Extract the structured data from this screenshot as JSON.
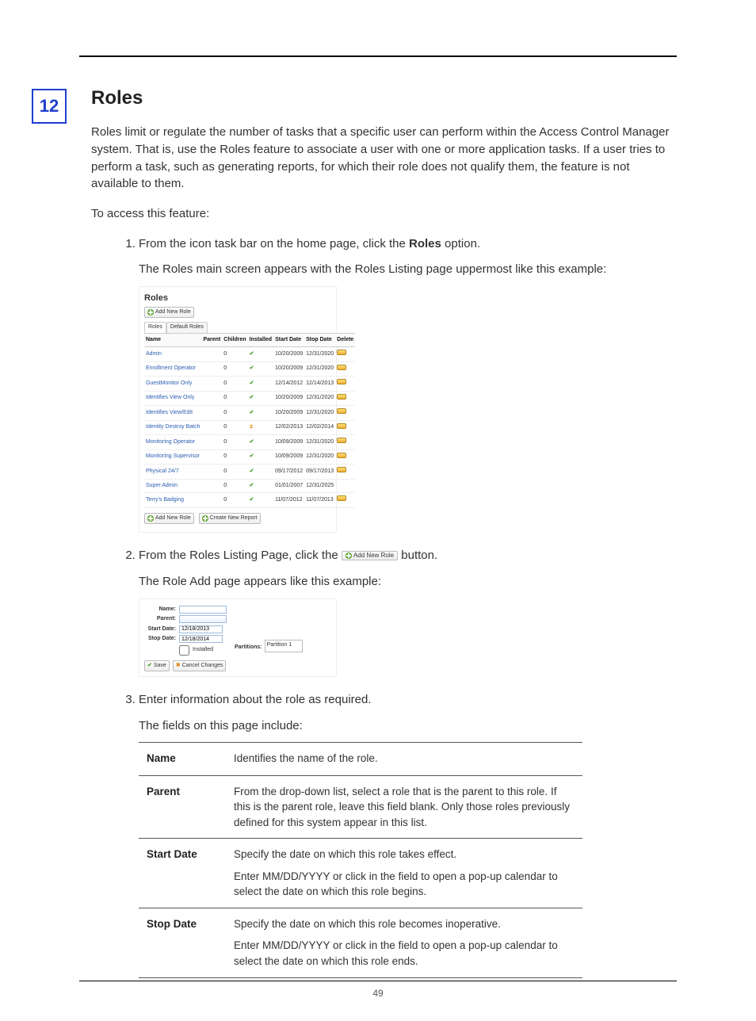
{
  "page": {
    "chapter_number": "12",
    "title": "Roles",
    "intro": "Roles limit or regulate the number of tasks that a specific user can perform within the Access Control Manager system. That is, use the Roles feature to associate a user with one or more application tasks. If a user tries to perform a task, such as generating reports, for which their role does not qualify them, the feature is not available to them.",
    "access_lead": "To access this feature:",
    "page_number": "49"
  },
  "steps": {
    "s1_pre": "From the icon task bar on the home page, click the ",
    "s1_strong": "Roles",
    "s1_post": " option.",
    "s1_result": "The Roles main screen appears with the Roles Listing page uppermost like this example:",
    "s2_pre": "From the Roles Listing Page, click the ",
    "s2_post": " button.",
    "s2_result": "The Role Add page appears like this example:",
    "s3": "Enter information about the role as required.",
    "s3_result": "The fields on this page include:"
  },
  "figure1": {
    "title": "Roles",
    "btn_add": "Add New Role",
    "btn_report": "Create New Report",
    "tab_roles": "Roles",
    "tab_default": "Default Roles",
    "headers": {
      "name": "Name",
      "parent": "Parent",
      "children": "Children",
      "installed": "Installed",
      "start": "Start Date",
      "stop": "Stop Date",
      "delete": "Delete"
    },
    "rows": [
      {
        "name": "Admin",
        "children": "0",
        "installed": "✔",
        "start": "10/20/2009",
        "stop": "12/31/2020",
        "del": true
      },
      {
        "name": "Enrollment Operator",
        "children": "0",
        "installed": "✔",
        "start": "10/20/2009",
        "stop": "12/31/2020",
        "del": true
      },
      {
        "name": "GuestMonitor Only",
        "children": "0",
        "installed": "✔",
        "start": "12/14/2012",
        "stop": "12/14/2013",
        "del": true
      },
      {
        "name": "Identifies View Only",
        "children": "0",
        "installed": "✔",
        "start": "10/20/2009",
        "stop": "12/31/2020",
        "del": true
      },
      {
        "name": "Identifies View/Edit",
        "children": "0",
        "installed": "✔",
        "start": "10/20/2009",
        "stop": "12/31/2020",
        "del": true
      },
      {
        "name": "Identity Destroy Batch",
        "children": "0",
        "installed": "⌛",
        "start": "12/02/2013",
        "stop": "12/02/2014",
        "del": true
      },
      {
        "name": "Monitoring Operator",
        "children": "0",
        "installed": "✔",
        "start": "10/09/2009",
        "stop": "12/31/2020",
        "del": true
      },
      {
        "name": "Monitoring Supervisor",
        "children": "0",
        "installed": "✔",
        "start": "10/09/2009",
        "stop": "12/31/2020",
        "del": true
      },
      {
        "name": "Physical 24/7",
        "children": "0",
        "installed": "✔",
        "start": "09/17/2012",
        "stop": "09/17/2013",
        "del": true
      },
      {
        "name": "Super Admin",
        "children": "0",
        "installed": "✔",
        "start": "01/01/2007",
        "stop": "12/31/2025",
        "del": false
      },
      {
        "name": "Terry's Badging",
        "children": "0",
        "installed": "✔",
        "start": "11/07/2012",
        "stop": "11/07/2013",
        "del": true
      }
    ]
  },
  "inline_btn": {
    "label": "Add New Role"
  },
  "figure2": {
    "lbl_name": "Name:",
    "lbl_parent": "Parent:",
    "lbl_start": "Start Date:",
    "lbl_stop": "Stop Date:",
    "val_start": "12/18/2013",
    "val_stop": "12/18/2014",
    "lbl_installed": "Installed",
    "lbl_partitions": "Partitions:",
    "partition_value": "Partition 1",
    "btn_save": "Save",
    "btn_cancel": "Cancel Changes"
  },
  "fields_table": [
    {
      "name": "Name",
      "desc": [
        "Identifies the name of the role."
      ]
    },
    {
      "name": "Parent",
      "desc": [
        "From the drop-down list, select a role that is the parent to this role. If this is the parent role, leave this field blank. Only those roles previously defined for this system appear in this list."
      ]
    },
    {
      "name": "Start Date",
      "desc": [
        "Specify the date on which this role takes effect.",
        "Enter MM/DD/YYYY or click in the field to open a pop-up calendar to select the date on which this role begins."
      ]
    },
    {
      "name": "Stop Date",
      "desc": [
        "Specify the date on which this role becomes inoperative.",
        "Enter MM/DD/YYYY or click in the field to open a pop-up calendar to select the date on which this role ends."
      ]
    }
  ]
}
